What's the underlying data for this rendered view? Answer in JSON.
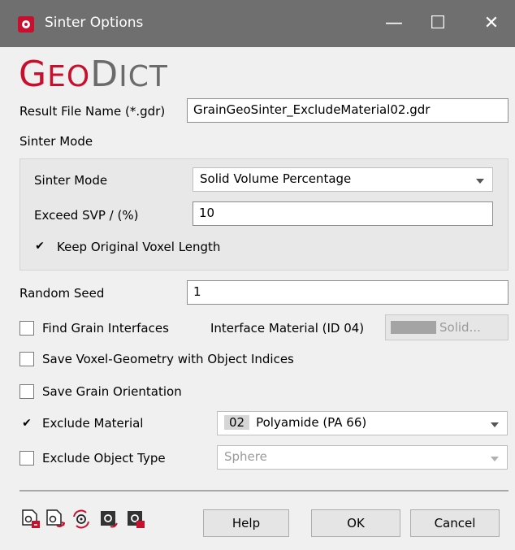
{
  "window": {
    "title": "Sinter Options",
    "minimize_glyph": "—",
    "maximize_glyph": "☐",
    "close_glyph": "✕"
  },
  "logo": {
    "first_letter": "G",
    "first_rest": "EO",
    "second_letter": "D",
    "second_rest": "ICT"
  },
  "result_file": {
    "label": "Result File Name (*.gdr)",
    "value": "GrainGeoSinter_ExcludeMaterial02.gdr"
  },
  "sinter_group": {
    "title": "Sinter Mode",
    "mode_label": "Sinter Mode",
    "mode_value": "Solid Volume Percentage",
    "exceed_label": "Exceed SVP / (%)",
    "exceed_value": "10",
    "keep_voxel": {
      "label": "Keep Original Voxel Length",
      "checked": true
    }
  },
  "random_seed": {
    "label": "Random Seed",
    "value": "1"
  },
  "find_grain": {
    "label": "Find Grain Interfaces",
    "checked": false
  },
  "interface_material": {
    "label": "Interface Material (ID 04)",
    "button_label": "Solid...",
    "swatch_color": "#a4a4a4"
  },
  "save_voxel": {
    "label": "Save Voxel-Geometry with Object Indices",
    "checked": false
  },
  "save_orientation": {
    "label": "Save Grain Orientation",
    "checked": false
  },
  "exclude_material": {
    "label": "Exclude Material",
    "checked": true,
    "id": "02",
    "value": "Polyamide (PA 66)"
  },
  "exclude_object": {
    "label": "Exclude Object Type",
    "checked": false,
    "value": "Sphere"
  },
  "toolbar_icons": [
    "load-settings-icon",
    "save-settings-icon",
    "reset-settings-icon",
    "import-settings-icon",
    "export-settings-icon"
  ],
  "buttons": {
    "help": "Help",
    "ok": "OK",
    "cancel": "Cancel"
  },
  "colors": {
    "brand_red": "#c8102e",
    "title_bar": "#6f6f6f"
  }
}
